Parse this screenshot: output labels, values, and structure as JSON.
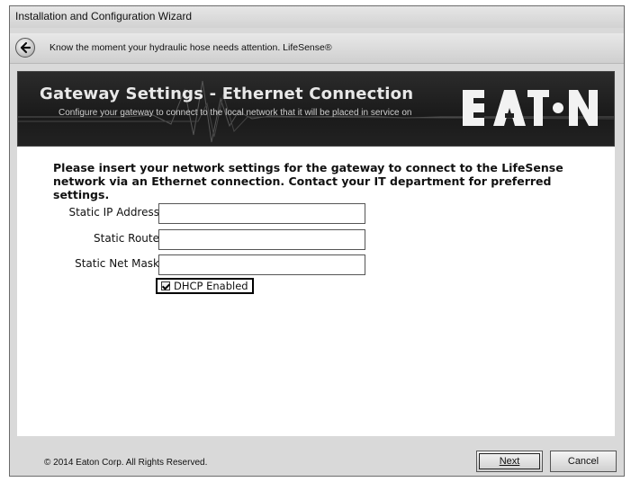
{
  "window": {
    "title": "Installation and Configuration Wizard"
  },
  "nav": {
    "back_icon": "back-arrow-icon",
    "tagline": "Know the moment your hydraulic hose needs attention.  LifeSense®"
  },
  "banner": {
    "title": "Gateway Settings - Ethernet Connection",
    "subtitle": "Configure your gateway to connect to the local network that it will be placed in service on",
    "logo": "EATON"
  },
  "form": {
    "instructions": "Please insert your network settings for the gateway to connect to the LifeSense network via an Ethernet connection.  Contact your IT department for preferred settings.",
    "fields": [
      {
        "label": "Static IP Address",
        "value": ""
      },
      {
        "label": "Static Route",
        "value": ""
      },
      {
        "label": "Static Net Mask",
        "value": ""
      }
    ],
    "dhcp": {
      "label": "DHCP Enabled",
      "checked": true
    }
  },
  "footer": {
    "copyright": "© 2014 Eaton Corp.  All Rights Reserved.",
    "next_label": "Next",
    "cancel_label": "Cancel"
  },
  "colors": {
    "banner_bg": "#1f1f1f",
    "window_bg": "#d9d9d9"
  }
}
